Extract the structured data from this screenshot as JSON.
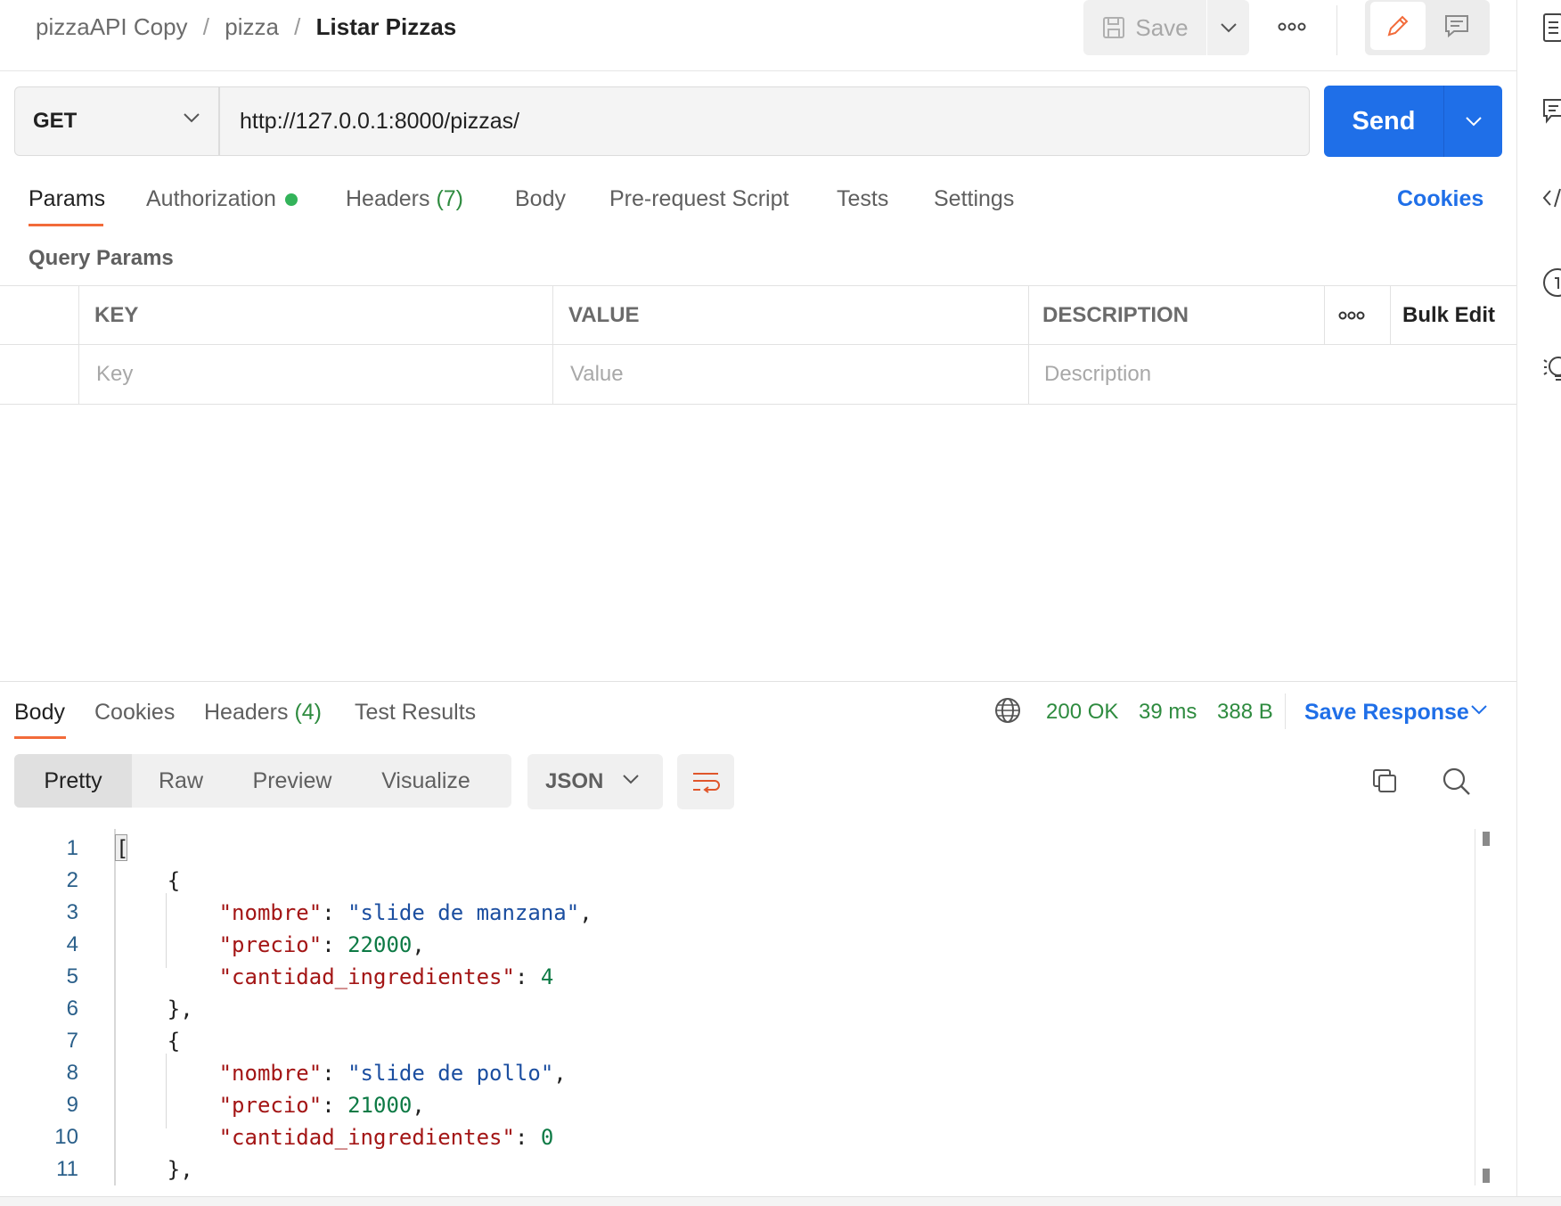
{
  "breadcrumb": {
    "collection": "pizzaAPI Copy",
    "folder": "pizza",
    "request": "Listar Pizzas",
    "separator": "/"
  },
  "toolbar": {
    "save_label": "Save"
  },
  "request": {
    "method": "GET",
    "url": "http://127.0.0.1:8000/pizzas/",
    "send_label": "Send"
  },
  "request_tabs": {
    "params": "Params",
    "authorization": "Authorization",
    "headers": "Headers",
    "headers_count": "(7)",
    "body": "Body",
    "pre_request": "Pre-request Script",
    "tests": "Tests",
    "settings": "Settings",
    "cookies": "Cookies"
  },
  "query_params": {
    "title": "Query Params",
    "columns": {
      "key": "KEY",
      "value": "VALUE",
      "description": "DESCRIPTION"
    },
    "bulk_edit": "Bulk Edit",
    "placeholders": {
      "key": "Key",
      "value": "Value",
      "description": "Description"
    }
  },
  "response_tabs": {
    "body": "Body",
    "cookies": "Cookies",
    "headers": "Headers",
    "headers_count": "(4)",
    "test_results": "Test Results"
  },
  "response_status": {
    "status": "200 OK",
    "time": "39 ms",
    "size": "388 B",
    "save_response": "Save Response"
  },
  "response_view": {
    "pretty": "Pretty",
    "raw": "Raw",
    "preview": "Preview",
    "visualize": "Visualize",
    "format": "JSON"
  },
  "code": {
    "line_numbers": [
      "1",
      "2",
      "3",
      "4",
      "5",
      "6",
      "7",
      "8",
      "9",
      "10",
      "11"
    ],
    "items": [
      {
        "k_nombre": "\"nombre\"",
        "v_nombre": "\"slide de manzana\"",
        "k_precio": "\"precio\"",
        "v_precio": "22000",
        "k_cant": "\"cantidad_ingredientes\"",
        "v_cant": "4"
      },
      {
        "k_nombre": "\"nombre\"",
        "v_nombre": "\"slide de pollo\"",
        "k_precio": "\"precio\"",
        "v_precio": "21000",
        "k_cant": "\"cantidad_ingredientes\"",
        "v_cant": "0"
      }
    ]
  },
  "colors": {
    "accent_orange": "#f26b3a",
    "send_blue": "#1f6fe8",
    "status_green": "#2e8b3f"
  }
}
